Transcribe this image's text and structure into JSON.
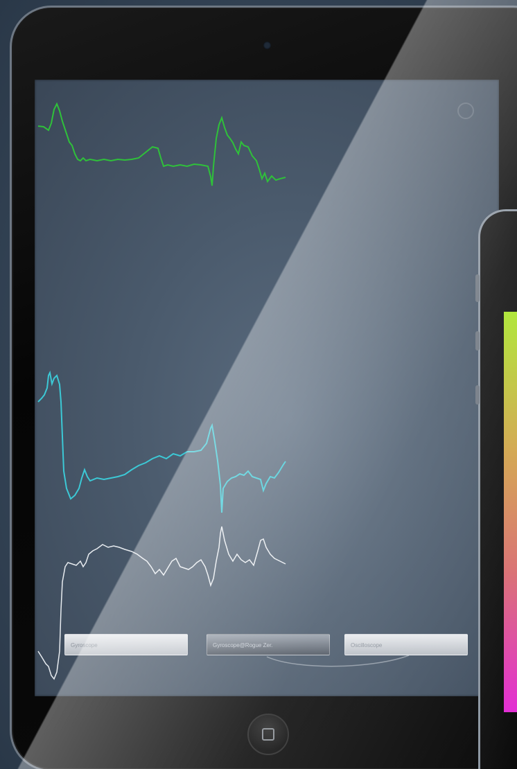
{
  "app": {
    "title": ""
  },
  "buttons": [
    {
      "label": "Gyroscope"
    },
    {
      "label": "Gyroscope@Rogue Zer."
    },
    {
      "label": "Oscilloscope"
    }
  ],
  "traces": {
    "colors": {
      "green": "#2fc13a",
      "cyan": "#3cc9d6",
      "white": "#e8ecf0"
    }
  },
  "icons": {
    "settings": "gear-icon",
    "home": "home-button-icon",
    "camera": "camera-icon"
  },
  "devices": {
    "secondary_screen_gradient": [
      "#a8e426",
      "#e22bd4"
    ]
  }
}
